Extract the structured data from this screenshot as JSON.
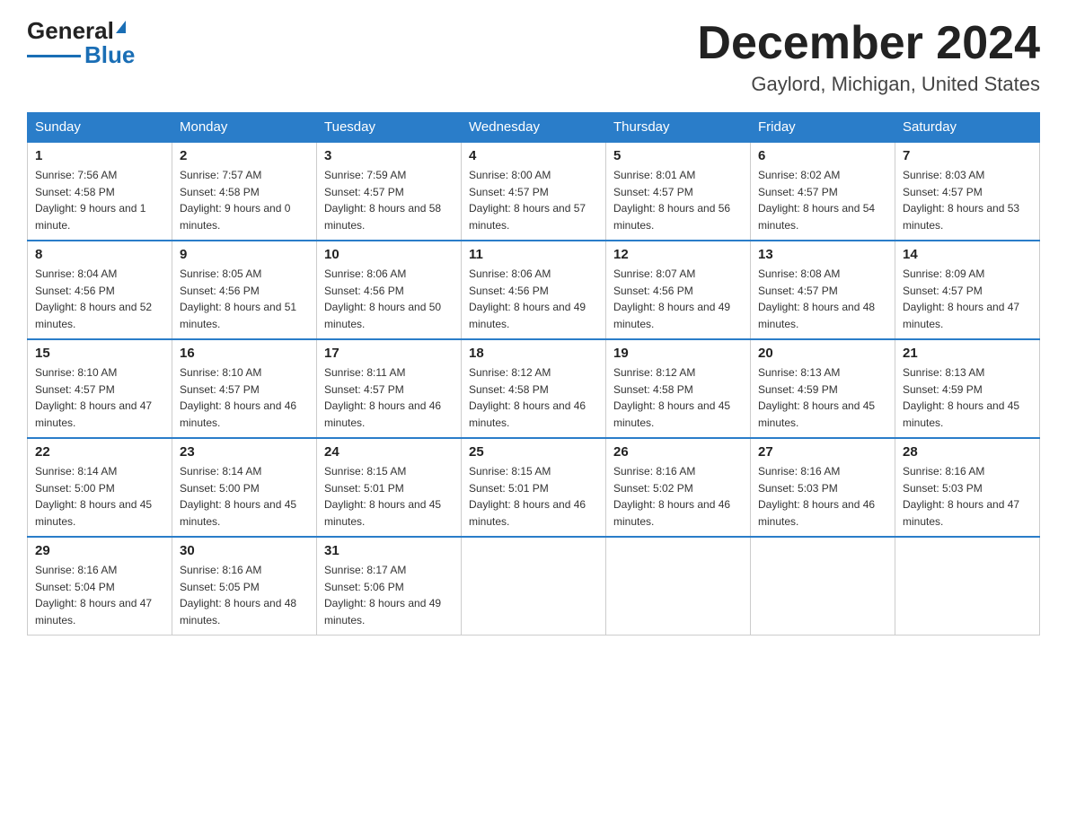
{
  "header": {
    "logo_general": "General",
    "logo_blue": "Blue",
    "month_title": "December 2024",
    "location": "Gaylord, Michigan, United States"
  },
  "weekdays": [
    "Sunday",
    "Monday",
    "Tuesday",
    "Wednesday",
    "Thursday",
    "Friday",
    "Saturday"
  ],
  "weeks": [
    [
      {
        "day": "1",
        "sunrise": "7:56 AM",
        "sunset": "4:58 PM",
        "daylight": "9 hours and 1 minute."
      },
      {
        "day": "2",
        "sunrise": "7:57 AM",
        "sunset": "4:58 PM",
        "daylight": "9 hours and 0 minutes."
      },
      {
        "day": "3",
        "sunrise": "7:59 AM",
        "sunset": "4:57 PM",
        "daylight": "8 hours and 58 minutes."
      },
      {
        "day": "4",
        "sunrise": "8:00 AM",
        "sunset": "4:57 PM",
        "daylight": "8 hours and 57 minutes."
      },
      {
        "day": "5",
        "sunrise": "8:01 AM",
        "sunset": "4:57 PM",
        "daylight": "8 hours and 56 minutes."
      },
      {
        "day": "6",
        "sunrise": "8:02 AM",
        "sunset": "4:57 PM",
        "daylight": "8 hours and 54 minutes."
      },
      {
        "day": "7",
        "sunrise": "8:03 AM",
        "sunset": "4:57 PM",
        "daylight": "8 hours and 53 minutes."
      }
    ],
    [
      {
        "day": "8",
        "sunrise": "8:04 AM",
        "sunset": "4:56 PM",
        "daylight": "8 hours and 52 minutes."
      },
      {
        "day": "9",
        "sunrise": "8:05 AM",
        "sunset": "4:56 PM",
        "daylight": "8 hours and 51 minutes."
      },
      {
        "day": "10",
        "sunrise": "8:06 AM",
        "sunset": "4:56 PM",
        "daylight": "8 hours and 50 minutes."
      },
      {
        "day": "11",
        "sunrise": "8:06 AM",
        "sunset": "4:56 PM",
        "daylight": "8 hours and 49 minutes."
      },
      {
        "day": "12",
        "sunrise": "8:07 AM",
        "sunset": "4:56 PM",
        "daylight": "8 hours and 49 minutes."
      },
      {
        "day": "13",
        "sunrise": "8:08 AM",
        "sunset": "4:57 PM",
        "daylight": "8 hours and 48 minutes."
      },
      {
        "day": "14",
        "sunrise": "8:09 AM",
        "sunset": "4:57 PM",
        "daylight": "8 hours and 47 minutes."
      }
    ],
    [
      {
        "day": "15",
        "sunrise": "8:10 AM",
        "sunset": "4:57 PM",
        "daylight": "8 hours and 47 minutes."
      },
      {
        "day": "16",
        "sunrise": "8:10 AM",
        "sunset": "4:57 PM",
        "daylight": "8 hours and 46 minutes."
      },
      {
        "day": "17",
        "sunrise": "8:11 AM",
        "sunset": "4:57 PM",
        "daylight": "8 hours and 46 minutes."
      },
      {
        "day": "18",
        "sunrise": "8:12 AM",
        "sunset": "4:58 PM",
        "daylight": "8 hours and 46 minutes."
      },
      {
        "day": "19",
        "sunrise": "8:12 AM",
        "sunset": "4:58 PM",
        "daylight": "8 hours and 45 minutes."
      },
      {
        "day": "20",
        "sunrise": "8:13 AM",
        "sunset": "4:59 PM",
        "daylight": "8 hours and 45 minutes."
      },
      {
        "day": "21",
        "sunrise": "8:13 AM",
        "sunset": "4:59 PM",
        "daylight": "8 hours and 45 minutes."
      }
    ],
    [
      {
        "day": "22",
        "sunrise": "8:14 AM",
        "sunset": "5:00 PM",
        "daylight": "8 hours and 45 minutes."
      },
      {
        "day": "23",
        "sunrise": "8:14 AM",
        "sunset": "5:00 PM",
        "daylight": "8 hours and 45 minutes."
      },
      {
        "day": "24",
        "sunrise": "8:15 AM",
        "sunset": "5:01 PM",
        "daylight": "8 hours and 45 minutes."
      },
      {
        "day": "25",
        "sunrise": "8:15 AM",
        "sunset": "5:01 PM",
        "daylight": "8 hours and 46 minutes."
      },
      {
        "day": "26",
        "sunrise": "8:16 AM",
        "sunset": "5:02 PM",
        "daylight": "8 hours and 46 minutes."
      },
      {
        "day": "27",
        "sunrise": "8:16 AM",
        "sunset": "5:03 PM",
        "daylight": "8 hours and 46 minutes."
      },
      {
        "day": "28",
        "sunrise": "8:16 AM",
        "sunset": "5:03 PM",
        "daylight": "8 hours and 47 minutes."
      }
    ],
    [
      {
        "day": "29",
        "sunrise": "8:16 AM",
        "sunset": "5:04 PM",
        "daylight": "8 hours and 47 minutes."
      },
      {
        "day": "30",
        "sunrise": "8:16 AM",
        "sunset": "5:05 PM",
        "daylight": "8 hours and 48 minutes."
      },
      {
        "day": "31",
        "sunrise": "8:17 AM",
        "sunset": "5:06 PM",
        "daylight": "8 hours and 49 minutes."
      },
      null,
      null,
      null,
      null
    ]
  ],
  "labels": {
    "sunrise": "Sunrise:",
    "sunset": "Sunset:",
    "daylight": "Daylight:"
  }
}
